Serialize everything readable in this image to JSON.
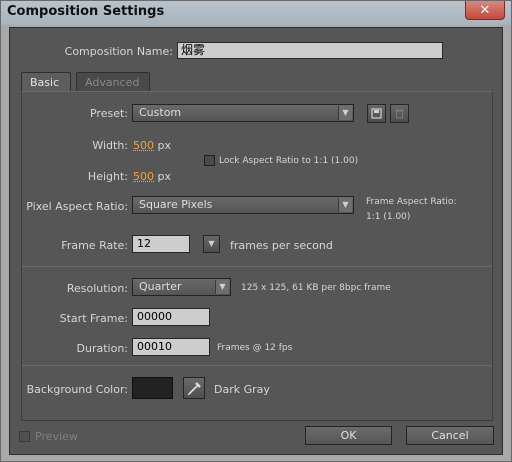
{
  "window": {
    "title": "Composition Settings",
    "close_glyph": "✕"
  },
  "comp_name": {
    "label": "Composition Name:",
    "value": "烟雾"
  },
  "tabs": [
    {
      "label": "Basic",
      "active": true
    },
    {
      "label": "Advanced",
      "active": false
    }
  ],
  "preset": {
    "label": "Preset:",
    "value": "Custom"
  },
  "width": {
    "label": "Width:",
    "value": "500",
    "unit": "px"
  },
  "height": {
    "label": "Height:",
    "value": "500",
    "unit": "px"
  },
  "lock_aspect": {
    "label": "Lock Aspect Ratio to 1:1 (1.00)",
    "checked": false
  },
  "pixel_aspect": {
    "label": "Pixel Aspect Ratio:",
    "value": "Square Pixels"
  },
  "frame_aspect": {
    "label": "Frame Aspect Ratio:",
    "value": "1:1 (1.00)"
  },
  "frame_rate": {
    "label": "Frame Rate:",
    "value": "12",
    "suffix": "frames per second"
  },
  "resolution": {
    "label": "Resolution:",
    "value": "Quarter",
    "info": "125 x 125, 61 KB per 8bpc frame"
  },
  "start_frame": {
    "label": "Start Frame:",
    "value": "00000"
  },
  "duration": {
    "label": "Duration:",
    "value": "00010",
    "info": "Frames @ 12 fps"
  },
  "background": {
    "label": "Background Color:",
    "color_name": "Dark Gray",
    "color": "#222222"
  },
  "preview": {
    "label": "Preview",
    "checked": false,
    "enabled": false
  },
  "buttons": {
    "ok": "OK",
    "cancel": "Cancel"
  },
  "icons": {
    "dropdown": "▼",
    "save_preset": "save-preset-icon",
    "delete_preset": "trash-icon",
    "eyedropper": "eyedropper-icon"
  }
}
